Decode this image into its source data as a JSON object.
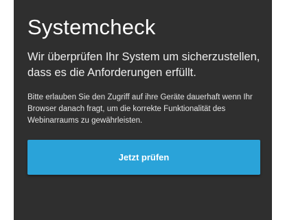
{
  "panel": {
    "title": "Systemcheck",
    "lead": "Wir überprüfen Ihr System um sicherzustellen, dass es die Anforderungen erfüllt.",
    "note": "Bitte erlauben Sie den Zugriff auf ihre Geräte dauerhaft wenn Ihr Browser danach fragt, um die korrekte Funktionalität des Webinarraums zu gewährleisten.",
    "button_label": "Jetzt prüfen"
  },
  "colors": {
    "panel_background": "#2f2f2f",
    "button_background": "#2aa3d9",
    "text": "#ffffff"
  }
}
